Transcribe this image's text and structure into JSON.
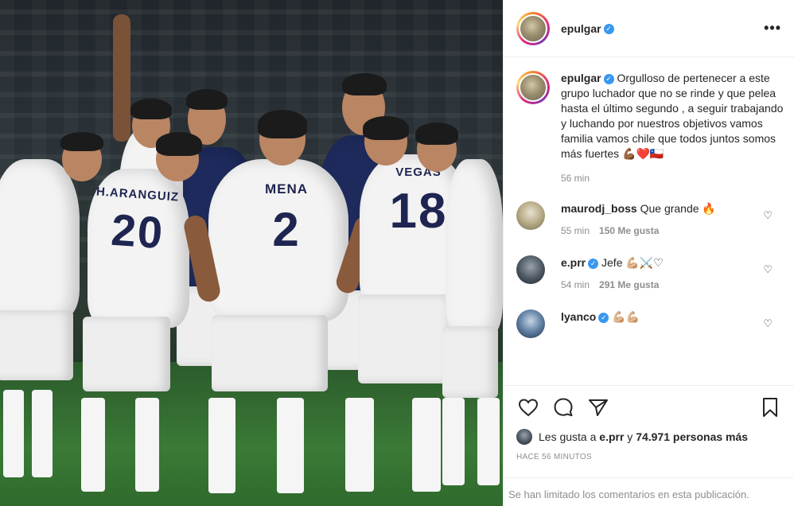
{
  "post": {
    "author": "epulgar",
    "caption": "Orgulloso de pertenecer a este grupo luchador que no se rinde y que pelea hasta el último segundo , a seguir trabajando y luchando por nuestros objetivos vamos familia vamos chile que todos juntos somos más fuertes 💪🏾❤️🇨🇱",
    "caption_time": "56 min",
    "like_summary": {
      "prefix": "Les gusta a",
      "user": "e.prr",
      "joiner": "y",
      "count": "74.971 personas más"
    },
    "posted_ago": "HACE 56 MINUTOS",
    "comments_limited": "Se han limitado los comentarios en esta publicación."
  },
  "photo": {
    "jerseys": [
      {
        "name": "H.ARANGUIZ",
        "number": "20"
      },
      {
        "name": "MENA",
        "number": "2"
      },
      {
        "name": "VEGAS",
        "number": "18"
      }
    ]
  },
  "comments": [
    {
      "user": "maurodj_boss",
      "verified": false,
      "text": "Que grande 🔥",
      "time": "55 min",
      "likes": "150 Me gusta"
    },
    {
      "user": "e.prr",
      "verified": true,
      "text": "Jefe 💪🏼⚔️♡",
      "time": "54 min",
      "likes": "291 Me gusta"
    },
    {
      "user": "lyanco",
      "verified": true,
      "text": "💪🏼💪🏼",
      "time": "",
      "likes": ""
    }
  ],
  "icons": {
    "verified": "verified-badge-icon",
    "more": "more-options-icon",
    "like": "heart-icon",
    "comment": "comment-icon",
    "share": "paper-plane-icon",
    "save": "bookmark-icon"
  },
  "colors": {
    "verified_blue": "#3897f0",
    "muted_text": "#8e8e8e",
    "divider": "#efefef",
    "jersey_navy": "#1e2550"
  }
}
